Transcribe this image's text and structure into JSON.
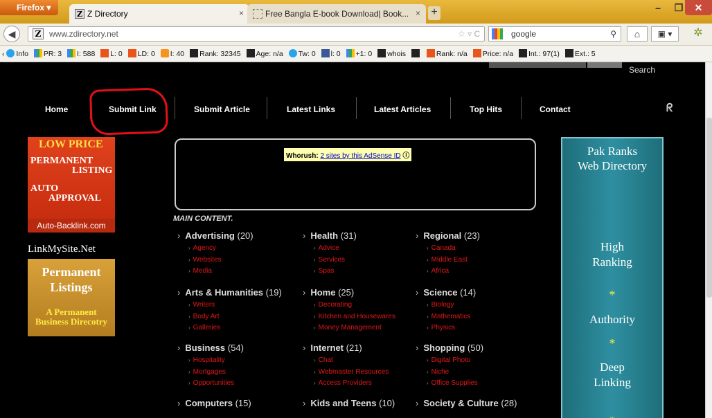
{
  "browser": {
    "menu_label": "Firefox",
    "tabs": [
      {
        "fav": "Z",
        "title": "Z Directory"
      },
      {
        "fav": "",
        "title": "Free Bangla E-book Download| Book..."
      }
    ],
    "new_tab": "+",
    "tab_close": "×",
    "url": "www.zdirectory.net",
    "url_fav": "Z",
    "search_engine": "google",
    "win_min": "–",
    "win_max": "❐",
    "win_close": "✕"
  },
  "seo_toolbar": [
    {
      "icon": "info-icon",
      "text": "Info"
    },
    {
      "icon": "google-icon",
      "text": "PR: 3"
    },
    {
      "icon": "google-icon",
      "text": "I: 588"
    },
    {
      "icon": "semrush-icon",
      "text": "L: 0"
    },
    {
      "icon": "semrush-icon",
      "text": "LD: 0"
    },
    {
      "icon": "bing-icon",
      "text": "I: 40"
    },
    {
      "icon": "alexa-icon",
      "text": "Rank: 32345"
    },
    {
      "icon": "archive-icon",
      "text": "Age: n/a"
    },
    {
      "icon": "twitter-icon",
      "text": "Tw: 0"
    },
    {
      "icon": "facebook-icon",
      "text": "l: 0"
    },
    {
      "icon": "google-plus-icon",
      "text": "+1: 0"
    },
    {
      "icon": "whois-icon",
      "text": "whois"
    },
    {
      "icon": "source-icon",
      "text": ""
    },
    {
      "icon": "semrush-icon",
      "text": "Rank: n/a"
    },
    {
      "icon": "semrush-icon",
      "text": "Price: n/a"
    },
    {
      "icon": "links-icon",
      "text": "Int.: 97(1)"
    },
    {
      "icon": "links-icon",
      "text": "Ext.: 5"
    }
  ],
  "site": {
    "search_button": "Search",
    "nav": [
      "Home",
      "Submit Link",
      "Submit Article",
      "Latest Links",
      "Latest Articles",
      "Top Hits",
      "Contact"
    ],
    "rss": "ᖇ",
    "whorush_label": "Whorush:",
    "whorush_link": "2 sites by this AdSense ID",
    "main_heading": "MAIN CONTENT.",
    "categories": [
      {
        "name": "Advertising",
        "count": "(20)",
        "subs": [
          "Agency",
          "Websites",
          "Media"
        ]
      },
      {
        "name": "Health",
        "count": "(31)",
        "subs": [
          "Advice",
          "Services",
          "Spas"
        ]
      },
      {
        "name": "Regional",
        "count": "(23)",
        "subs": [
          "Canada",
          "Middle East",
          "Africa"
        ]
      },
      {
        "name": "Arts & Humanities",
        "count": "(19)",
        "subs": [
          "Writers",
          "Body Art",
          "Galleries"
        ]
      },
      {
        "name": "Home",
        "count": "(25)",
        "subs": [
          "Decorating",
          "Kitchen and Housewares",
          "Money Management"
        ]
      },
      {
        "name": "Science",
        "count": "(14)",
        "subs": [
          "Biology",
          "Mathematics",
          "Physics"
        ]
      },
      {
        "name": "Business",
        "count": "(54)",
        "subs": [
          "Hospitality",
          "Mortgages",
          "Opportunities"
        ]
      },
      {
        "name": "Internet",
        "count": "(21)",
        "subs": [
          "Chat",
          "Webmaster Resources",
          "Access Providers"
        ]
      },
      {
        "name": "Shopping",
        "count": "(50)",
        "subs": [
          "Digital Photo",
          "Niche",
          "Office Supplies"
        ]
      },
      {
        "name": "Computers",
        "count": "(15)",
        "subs": []
      },
      {
        "name": "Kids and Teens",
        "count": "(10)",
        "subs": []
      },
      {
        "name": "Society & Culture",
        "count": "(28)",
        "subs": []
      }
    ]
  },
  "ads": {
    "low_price": {
      "line1": "LOW PRICE",
      "line2a": "PERMANENT",
      "line2b": "LISTING",
      "line3a": "AUTO",
      "line3b": "APPROVAL",
      "footer": "Auto-Backlink.com"
    },
    "linkmysite": "LinkMySite.Net",
    "permanent": {
      "line1a": "Permanent",
      "line1b": "Listings",
      "line2a": "A Permanent",
      "line2b": "Business Direcotry"
    },
    "pak_ranks": {
      "title_a": "Pak Ranks",
      "title_b": "Web Directory",
      "high_a": "High",
      "high_b": "Ranking",
      "star": "*",
      "authority": "Authority",
      "deep_a": "Deep",
      "deep_b": "Linking"
    }
  },
  "colors": {
    "annotation": "#e3101a",
    "category_link": "#e01818",
    "tab_bar": "#e0ad30"
  }
}
